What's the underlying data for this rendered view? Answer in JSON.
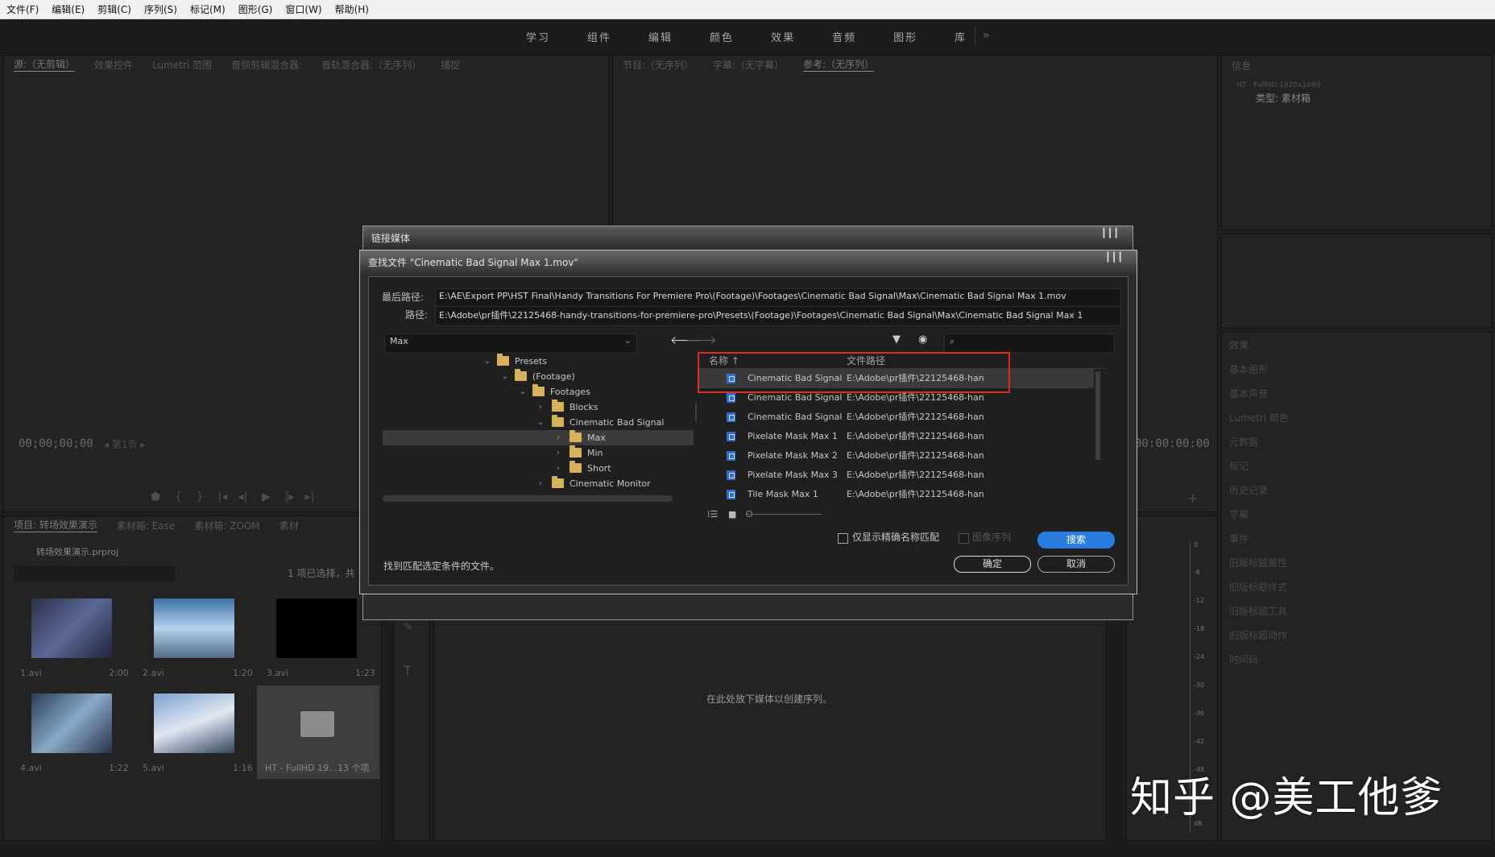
{
  "menu": [
    "文件(F)",
    "编辑(E)",
    "剪辑(C)",
    "序列(S)",
    "标记(M)",
    "图形(G)",
    "窗口(W)",
    "帮助(H)"
  ],
  "workspaces": [
    "学习",
    "组件",
    "编辑",
    "颜色",
    "效果",
    "音频",
    "图形",
    "库"
  ],
  "workspace_more": "»",
  "source_panel": {
    "tabs": [
      "源:（无剪辑）",
      "效果控件",
      "Lumetri 范围",
      "音频剪辑混合器:",
      "音轨混合器:（无序列）",
      "捕捉"
    ],
    "timecode": "00;00;00;00",
    "page": "第1页"
  },
  "program_panel": {
    "tabs": [
      "节目:（无序列）",
      "字幕:（无字幕）",
      "参考:（无序列）"
    ],
    "timecode": "00:00:00:00"
  },
  "info_panel": {
    "tab": "信息",
    "line1": "HT - FullHD 1920x1080",
    "line2": "类型: 素材箱"
  },
  "right_panels": [
    "效果",
    "基本图形",
    "基本声音",
    "Lumetri 颜色",
    "元数据",
    "标记",
    "历史记录",
    "字幕",
    "事件",
    "旧版标题属性",
    "旧版标题样式",
    "旧版标题工具",
    "旧版标题动作",
    "时间码"
  ],
  "project_panel": {
    "tabs": [
      "项目: 转场效果演示",
      "素材箱: Ease",
      "素材箱: ZOOM",
      "素材"
    ],
    "project_file": "转场效果演示.prproj",
    "selection_info": "1 项已选择，共",
    "items": [
      {
        "name": "1.avi",
        "duration": "2:00"
      },
      {
        "name": "2.avi",
        "duration": "1:20"
      },
      {
        "name": "3.avi",
        "duration": "1:23"
      },
      {
        "name": "4.avi",
        "duration": "1:22"
      },
      {
        "name": "5.avi",
        "duration": "1:16"
      },
      {
        "name": "HT - FullHD 19...",
        "duration": "13 个项"
      }
    ]
  },
  "timeline_hint": "在此处放下媒体以创建序列。",
  "meter_labels": [
    "0",
    "-6",
    "-12",
    "-18",
    "-24",
    "-30",
    "-36",
    "-42",
    "-48",
    "dB"
  ],
  "link_media_dialog": {
    "title": "链接媒体"
  },
  "locate_dialog": {
    "title": "查找文件 \"Cinematic Bad Signal Max 1.mov\"",
    "last_path_label": "最后路径:",
    "last_path": "E:\\AE\\Export PP\\HST Final\\Handy Transitions For Premiere Pro\\(Footage)\\Footages\\Cinematic Bad Signal\\Max\\Cinematic Bad Signal Max 1.mov",
    "path_label": "路径:",
    "path": "E:\\Adobe\\pr插件\\22125468-handy-transitions-for-premiere-pro\\Presets\\(Footage)\\Footages\\Cinematic Bad Signal\\Max\\Cinematic Bad Signal Max 1",
    "folder_dropdown": "Max",
    "tree": [
      {
        "label": "Presets",
        "depth": 0,
        "expanded": true
      },
      {
        "label": "(Footage)",
        "depth": 1,
        "expanded": true
      },
      {
        "label": "Footages",
        "depth": 2,
        "expanded": true
      },
      {
        "label": "Blocks",
        "depth": 3,
        "expanded": false
      },
      {
        "label": "Cinematic Bad Signal",
        "depth": 3,
        "expanded": true
      },
      {
        "label": "Max",
        "depth": 4,
        "expanded": false,
        "selected": true
      },
      {
        "label": "Min",
        "depth": 4,
        "expanded": false
      },
      {
        "label": "Short",
        "depth": 4,
        "expanded": false
      },
      {
        "label": "Cinematic Monitor",
        "depth": 3,
        "expanded": false
      }
    ],
    "col_name": "名称 ↑",
    "col_path": "文件路径",
    "files": [
      {
        "name": "Cinematic Bad Signal",
        "path": "E:\\Adobe\\pr插件\\22125468-han"
      },
      {
        "name": "Cinematic Bad Signal",
        "path": "E:\\Adobe\\pr插件\\22125468-han"
      },
      {
        "name": "Cinematic Bad Signal",
        "path": "E:\\Adobe\\pr插件\\22125468-han"
      },
      {
        "name": "Pixelate Mask Max 1",
        "path": "E:\\Adobe\\pr插件\\22125468-han"
      },
      {
        "name": "Pixelate Mask Max 2",
        "path": "E:\\Adobe\\pr插件\\22125468-han"
      },
      {
        "name": "Pixelate Mask Max 3",
        "path": "E:\\Adobe\\pr插件\\22125468-han"
      },
      {
        "name": "Tile Mask Max 1",
        "path": "E:\\Adobe\\pr插件\\22125468-han"
      }
    ],
    "exact_match_label": "仅显示精确名称匹配",
    "image_sequence_label": "图像序列",
    "search_button": "搜索",
    "status": "找到匹配选定条件的文件。",
    "ok_button": "确定",
    "cancel_button": "取消"
  },
  "watermark": "知乎 @美工他爹",
  "colors": {
    "accent": "#2a7de0",
    "highlight": "#e02a22",
    "folder": "#d8b25a"
  }
}
